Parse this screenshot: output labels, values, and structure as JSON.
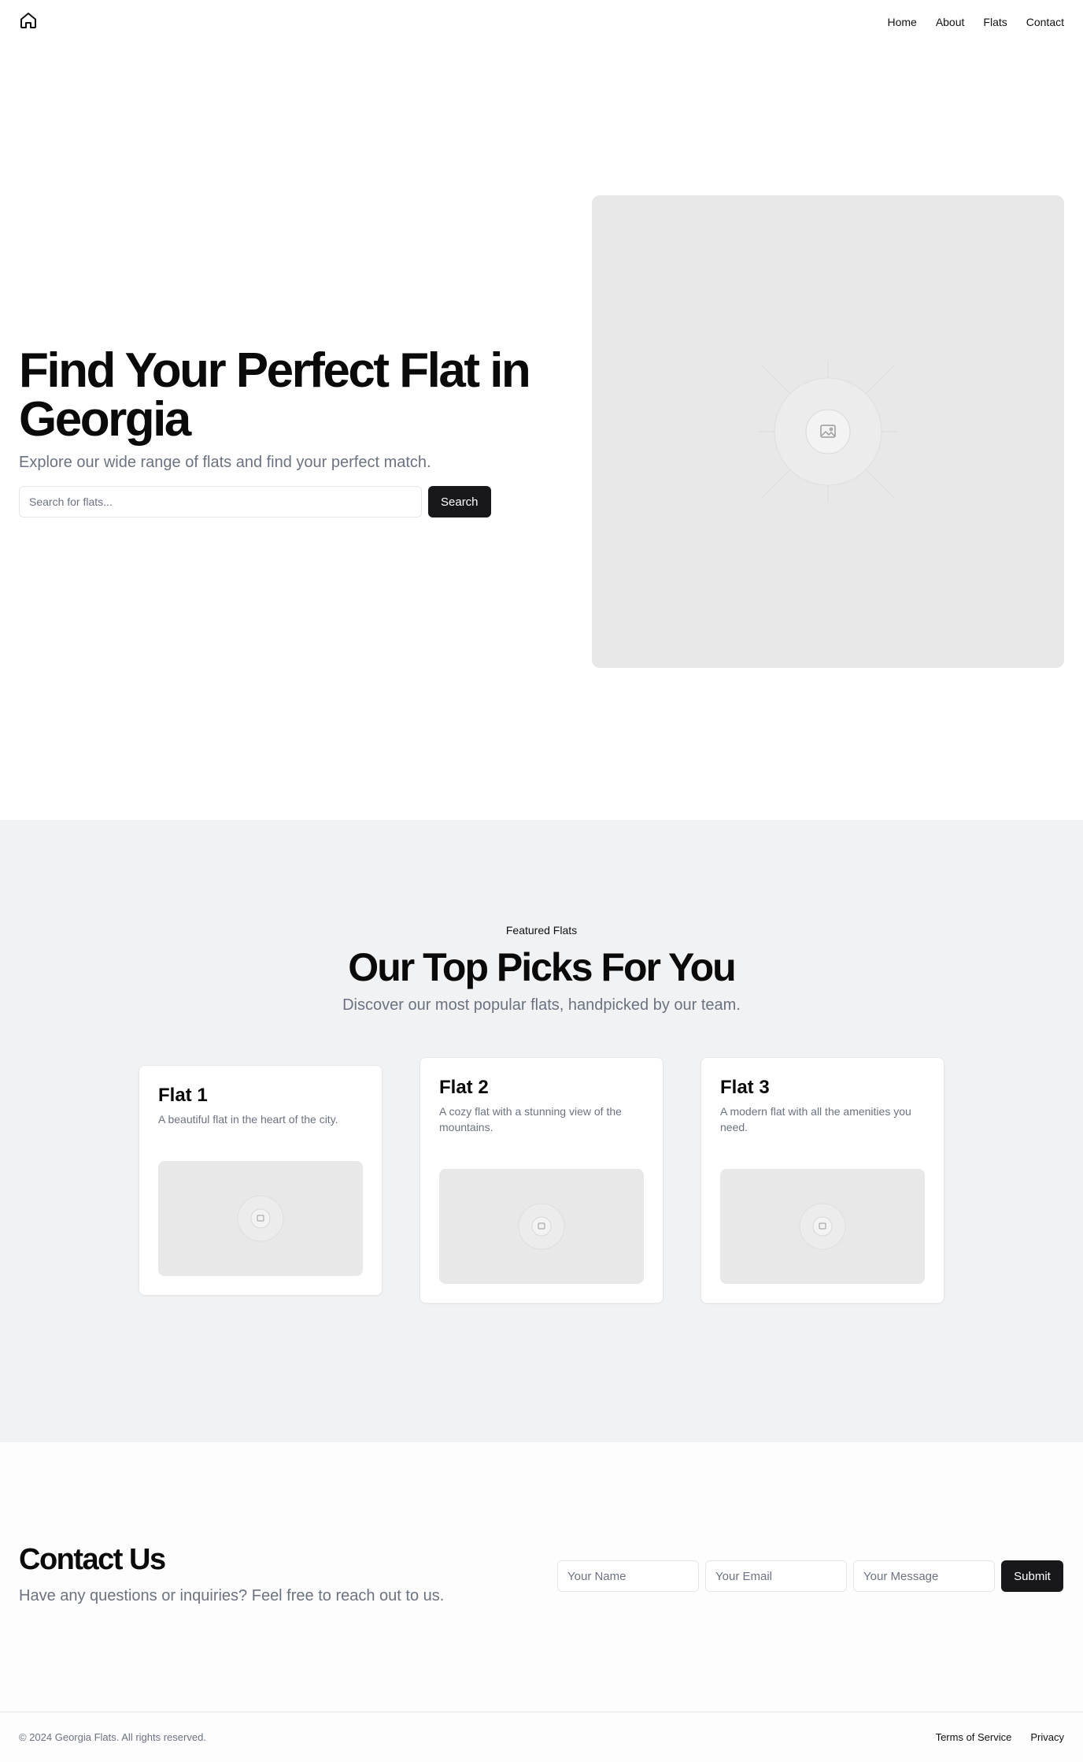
{
  "header": {
    "logo_icon": "home-icon",
    "nav": [
      {
        "label": "Home"
      },
      {
        "label": "About"
      },
      {
        "label": "Flats"
      },
      {
        "label": "Contact"
      }
    ]
  },
  "hero": {
    "title": "Find Your Perfect Flat in Georgia",
    "subtitle": "Explore our wide range of flats and find your perfect match.",
    "search_placeholder": "Search for flats...",
    "search_button": "Search",
    "image_icon": "image-placeholder-icon"
  },
  "featured": {
    "kicker": "Featured Flats",
    "title": "Our Top Picks For You",
    "subtitle": "Discover our most popular flats, handpicked by our team.",
    "cards": [
      {
        "title": "Flat 1",
        "description": "A beautiful flat in the heart of the city."
      },
      {
        "title": "Flat 2",
        "description": "A cozy flat with a stunning view of the mountains."
      },
      {
        "title": "Flat 3",
        "description": "A modern flat with all the amenities you need."
      }
    ]
  },
  "contact": {
    "title": "Contact Us",
    "subtitle": "Have any questions or inquiries? Feel free to reach out to us.",
    "name_placeholder": "Your Name",
    "email_placeholder": "Your Email",
    "message_placeholder": "Your Message",
    "submit_label": "Submit"
  },
  "footer": {
    "copyright": "© 2024 Georgia Flats. All rights reserved.",
    "links": [
      {
        "label": "Terms of Service"
      },
      {
        "label": "Privacy"
      }
    ]
  },
  "colors": {
    "primary_button": "#18181b",
    "featured_bg": "#f1f2f4",
    "image_placeholder": "#e8e8e8",
    "muted_text": "#6b7280"
  }
}
